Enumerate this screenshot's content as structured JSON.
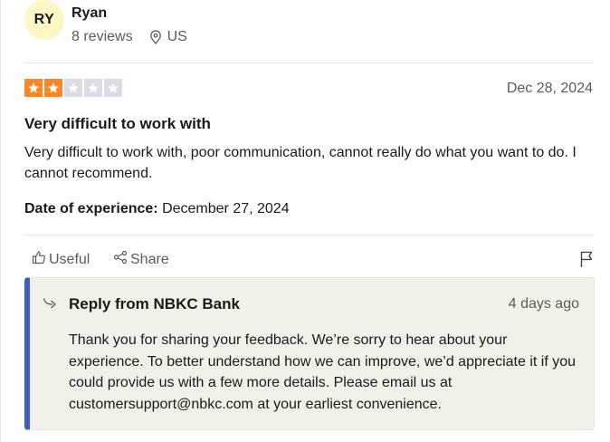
{
  "reviewer": {
    "initials": "RY",
    "name": "Ryan",
    "reviews_count": "8 reviews",
    "country": "US",
    "avatar_color": "#fdf7c6"
  },
  "review": {
    "rating": 2,
    "max_rating": 5,
    "star_color": "#ff8622",
    "date": "Dec 28, 2024",
    "title": "Very difficult to work with",
    "body": "Very difficult to work with, poor communication, cannot really do what you want to do. I cannot recommend.",
    "experience_label": "Date of experience:",
    "experience_date": "December 27, 2024"
  },
  "actions": {
    "useful_label": "Useful",
    "share_label": "Share"
  },
  "reply": {
    "title": "Reply from NBKC Bank",
    "date": "4 days ago",
    "text": "Thank you for sharing your feedback. We’re sorry to hear about your experience. To better understand how we can improve, we’d appreciate it if you could provide us with a few more details. Please email us at customersupport@nbkc.com at your earliest convenience.",
    "accent_color": "#3b5ec9"
  },
  "icons": {
    "location": "location-pin-icon",
    "useful": "thumbs-up-icon",
    "share": "share-icon",
    "report": "flag-icon",
    "reply": "reply-arrow-icon"
  }
}
